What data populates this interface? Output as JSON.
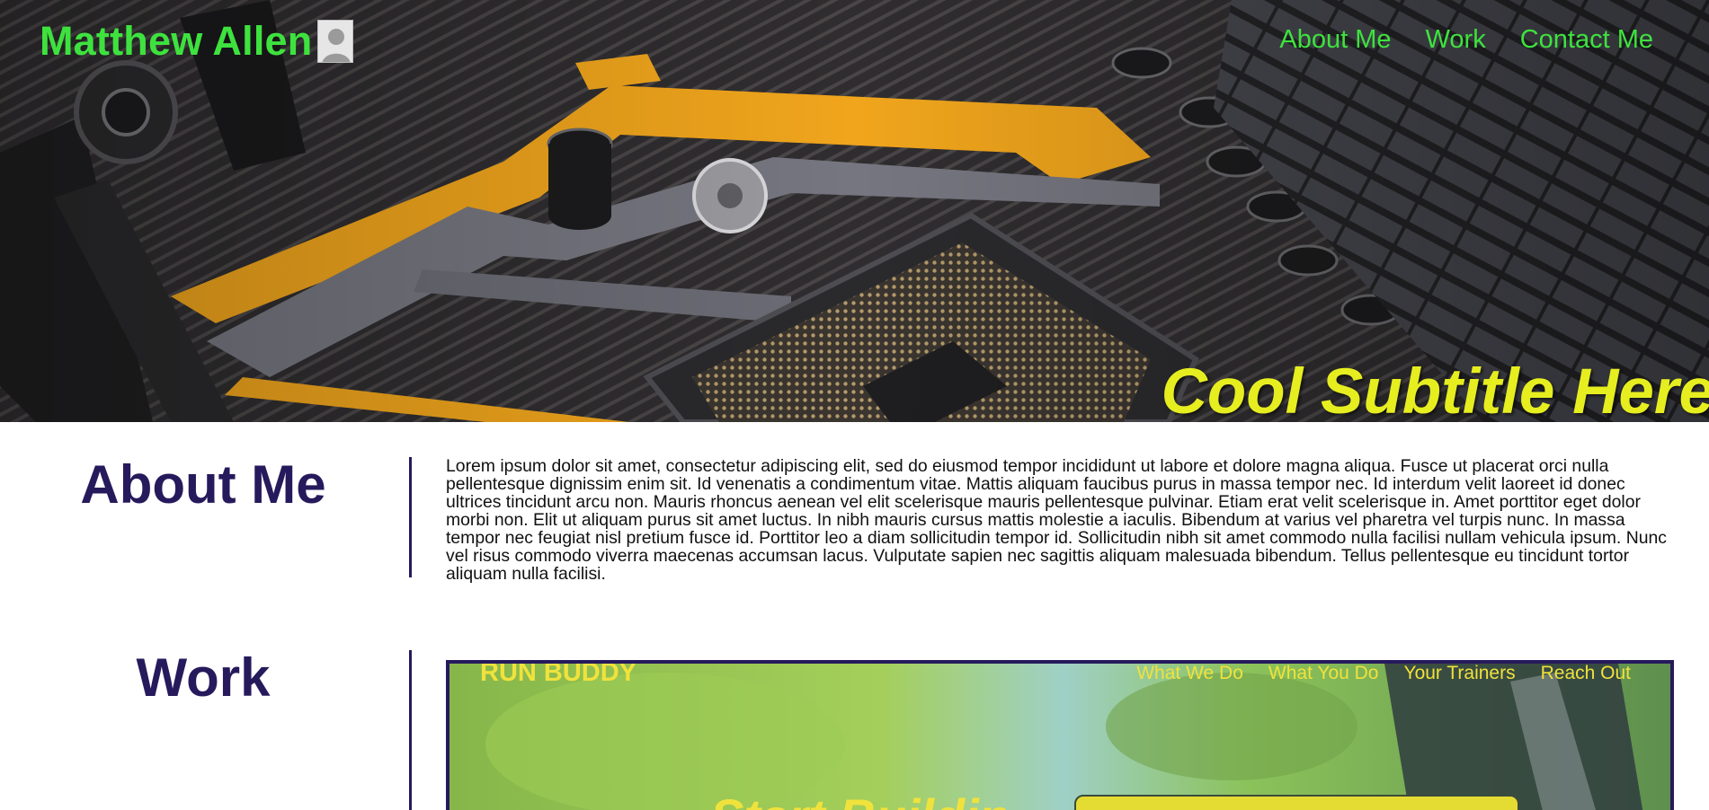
{
  "header": {
    "name": "Matthew Allen",
    "nav": [
      "About Me",
      "Work",
      "Contact Me"
    ],
    "subtitle": "Cool Subtitle Here"
  },
  "about": {
    "title": "About Me",
    "body": "Lorem ipsum dolor sit amet, consectetur adipiscing elit, sed do eiusmod tempor incididunt ut labore et dolore magna aliqua. Fusce ut placerat orci nulla pellentesque dignissim enim sit. Id venenatis a condimentum vitae. Mattis aliquam faucibus purus in massa tempor nec. Id interdum velit laoreet id donec ultrices tincidunt arcu non. Mauris rhoncus aenean vel elit scelerisque mauris pellentesque pulvinar. Etiam erat velit scelerisque in. Amet porttitor eget dolor morbi non. Elit ut aliquam purus sit amet luctus. In nibh mauris cursus mattis molestie a iaculis. Bibendum at varius vel pharetra vel turpis nunc. In massa tempor nec feugiat nisl pretium fusce id. Porttitor leo a diam sollicitudin tempor id. Sollicitudin nibh sit amet commodo nulla facilisi nullam vehicula ipsum. Nunc vel risus commodo viverra maecenas accumsan lacus. Vulputate sapien nec sagittis aliquam malesuada bibendum. Tellus pellentesque eu tincidunt tortor aliquam nulla facilisi."
  },
  "work": {
    "title": "Work",
    "preview": {
      "brand": "RUN BUDDY",
      "nav": [
        "What We Do",
        "What You Do",
        "Your Trainers",
        "Reach Out"
      ],
      "heading": "Start Buildin"
    }
  },
  "colors": {
    "accent_green": "#3ee23e",
    "subtitle_yellow": "#e6ee20",
    "heading_purple": "#261a5c"
  },
  "icons": [
    "avatar-placeholder-icon"
  ]
}
